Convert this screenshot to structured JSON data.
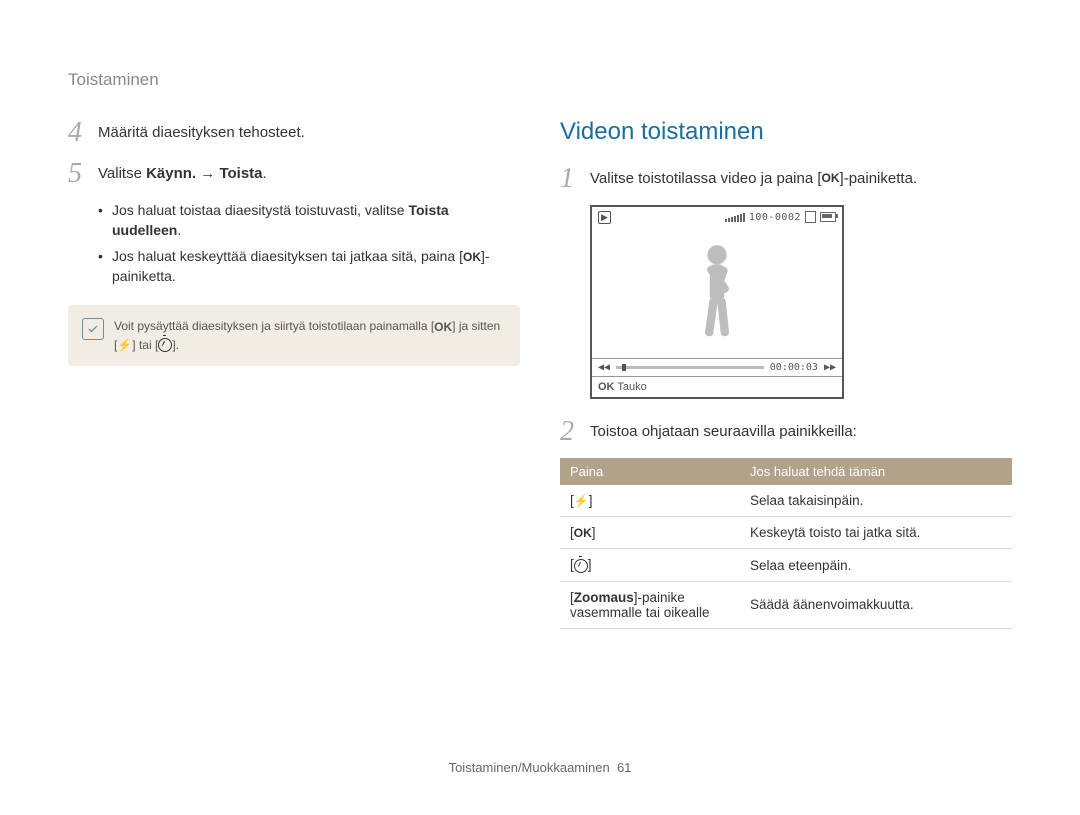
{
  "breadcrumb": "Toistaminen",
  "left": {
    "step4": {
      "num": "4",
      "text": "Määritä diaesityksen tehosteet."
    },
    "step5": {
      "num": "5",
      "prefix": "Valitse ",
      "bold1": "Käynn.",
      "arrow": " → ",
      "bold2": "Toista",
      "suffix": "."
    },
    "bullet1": {
      "prefix": "Jos haluat toistaa diaesitystä toistuvasti, valitse ",
      "bold": "Toista uudelleen",
      "suffix": "."
    },
    "bullet2": {
      "prefix": "Jos haluat keskeyttää diaesityksen tai jatkaa sitä, paina [",
      "ok": "OK",
      "suffix": "]-painiketta."
    },
    "note": {
      "text1": "Voit pysäyttää diaesityksen ja siirtyä toistotilaan painamalla [",
      "ok": "OK",
      "text2": "] ja sitten [",
      "text3": "] tai [",
      "text4": "]."
    }
  },
  "right": {
    "heading": "Videon toistaminen",
    "step1": {
      "num": "1",
      "prefix": "Valitse toistotilassa video ja paina [",
      "ok": "OK",
      "suffix": "]-painiketta."
    },
    "video": {
      "counter": "100-0002",
      "time": "00:00:03",
      "ok_label": "OK",
      "pause_label": "Tauko"
    },
    "step2": {
      "num": "2",
      "text": "Toistoa ohjataan seuraavilla painikkeilla:"
    },
    "table": {
      "header": {
        "col1": "Paina",
        "col2": "Jos haluat tehdä tämän"
      },
      "rows": [
        {
          "c1_pre": "[",
          "c1_icon": "flash",
          "c1_post": "]",
          "c2": "Selaa takaisinpäin."
        },
        {
          "c1_pre": "[",
          "c1_icon": "OK",
          "c1_post": "]",
          "c2": "Keskeytä toisto tai jatka sitä."
        },
        {
          "c1_pre": "[",
          "c1_icon": "timer",
          "c1_post": "]",
          "c2": "Selaa eteenpäin."
        },
        {
          "c1_pre": "[",
          "c1_bold": "Zoomaus",
          "c1_post": "]-painike vasemmalle tai oikealle",
          "c2": "Säädä äänenvoimakkuutta."
        }
      ]
    }
  },
  "footer": {
    "text": "Toistaminen/Muokkaaminen",
    "page": "61"
  }
}
